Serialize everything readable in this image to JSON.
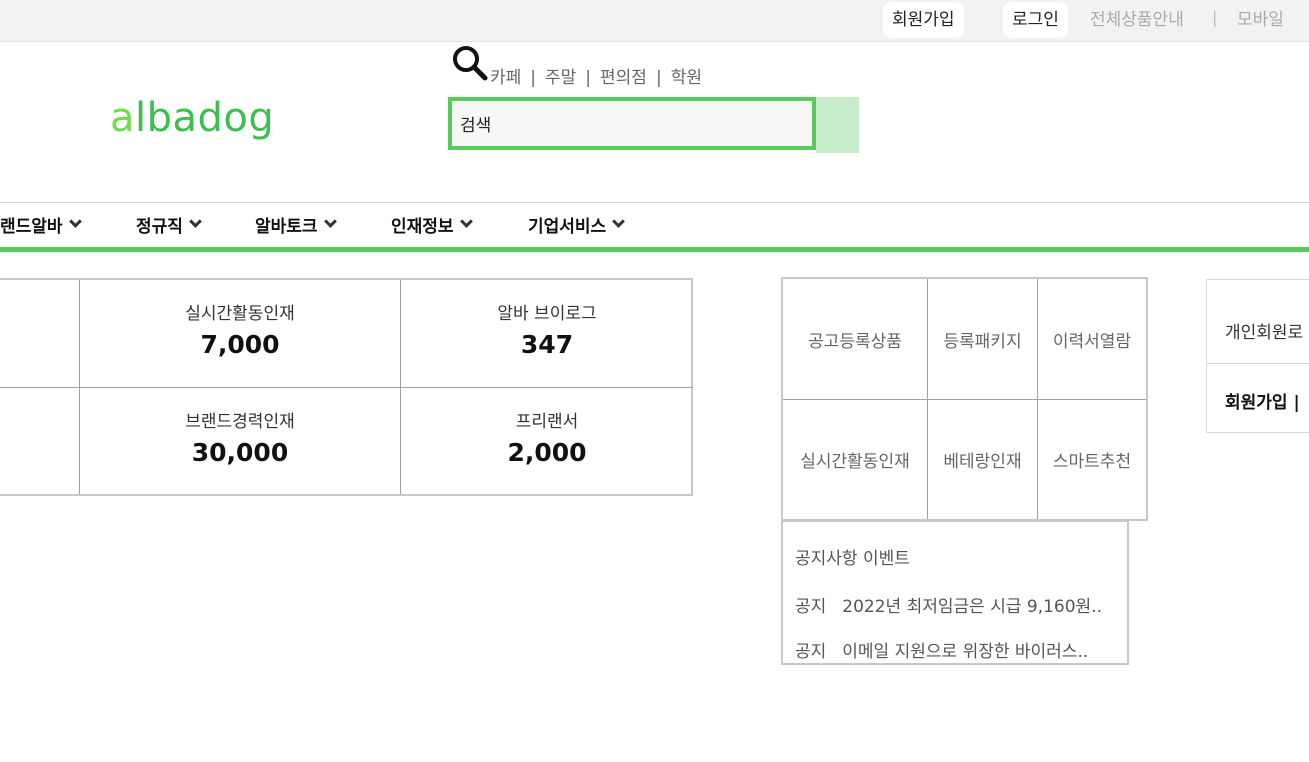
{
  "top_nav": {
    "signup": "회원가입",
    "login": "로그인",
    "all_products": "전체상품안내",
    "separator": "|",
    "mobile": "모바일"
  },
  "logo": {
    "text_first": "a",
    "text_rest": "lbadog"
  },
  "search": {
    "quick_links": [
      "카페",
      "주말",
      "편의점",
      "학원"
    ],
    "separator": "|",
    "placeholder": "검색"
  },
  "main_nav": {
    "items": [
      "랜드알바",
      "정규직",
      "알바토크",
      "인재정보",
      "기업서비스"
    ]
  },
  "stats": {
    "row1": [
      {
        "label": "실시간활동인재",
        "value": "7,000"
      },
      {
        "label": "알바 브이로그",
        "value": "347"
      }
    ],
    "row2": [
      {
        "label": "브랜드경력인재",
        "value": "30,000"
      },
      {
        "label": "프리랜서",
        "value": "2,000"
      }
    ]
  },
  "services": {
    "row1": [
      "공고등록상품",
      "등록패키지",
      "이력서열람"
    ],
    "row2": [
      "실시간활동인재",
      "베테랑인재",
      "스마트추천"
    ]
  },
  "notice": {
    "header": "공지사항 이벤트",
    "items": [
      {
        "tag": "공지",
        "text": "2022년 최저임금은 시급 9,160원.."
      },
      {
        "tag": "공지",
        "text": "이메일 지원으로 위장한 바이러스.."
      }
    ]
  },
  "login_panel": {
    "personal_login": "개인회원로",
    "signup": "회원가입 |"
  },
  "colors": {
    "accent_green": "#56cc5c",
    "logo_green": "#3cbf4c",
    "search_button": "#c6ecc9"
  }
}
